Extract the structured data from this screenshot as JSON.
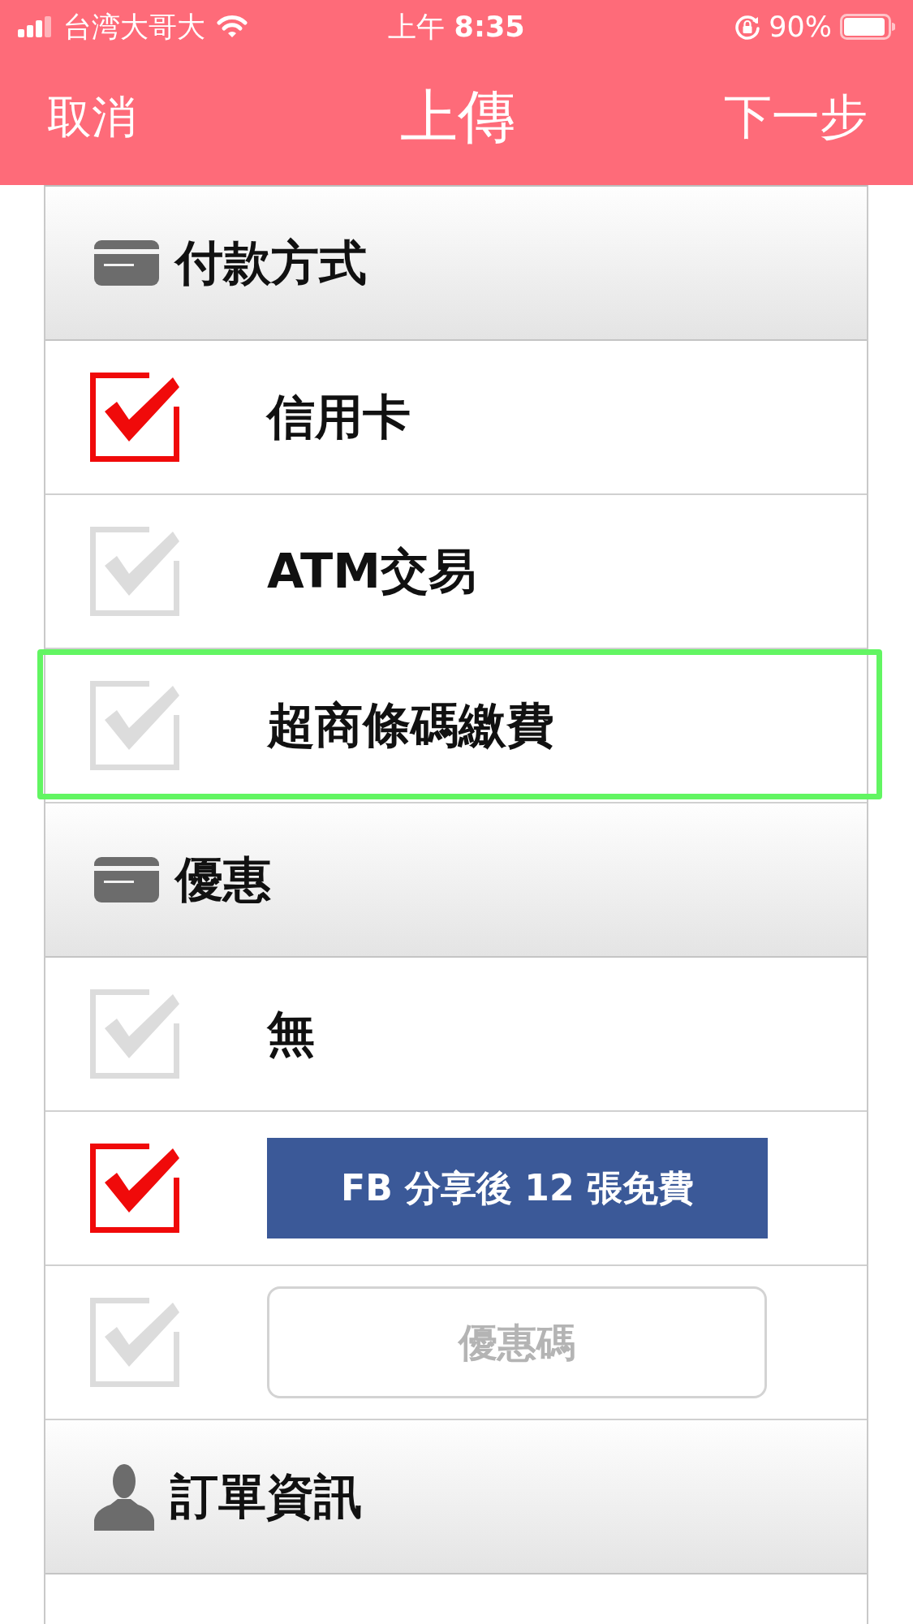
{
  "status_bar": {
    "carrier": "台湾大哥大",
    "time": "上午 **8:35**",
    "battery": "90%"
  },
  "nav_bar": {
    "left_button": "取消",
    "title": "上傳",
    "right_button": "下一步"
  },
  "sections": [
    {
      "kind": "card",
      "title": "付款方式",
      "options": [
        {
          "kind": "text",
          "label": "信用卡",
          "checked": true,
          "highlighted": false
        },
        {
          "kind": "text",
          "label": "ATM交易",
          "checked": false,
          "highlighted": false
        },
        {
          "kind": "text",
          "label": "超商條碼繳費",
          "checked": false,
          "highlighted": true
        }
      ]
    },
    {
      "kind": "card",
      "title": "優惠",
      "options": [
        {
          "kind": "text",
          "label": "無",
          "checked": false,
          "highlighted": false
        },
        {
          "kind": "button",
          "label": "FB 分享後 12 張免費",
          "checked": true,
          "highlighted": false
        },
        {
          "kind": "field",
          "placeholder": "優惠碼",
          "checked": false,
          "highlighted": false
        }
      ]
    },
    {
      "kind": "person",
      "title": "訂單資訊"
    }
  ]
}
